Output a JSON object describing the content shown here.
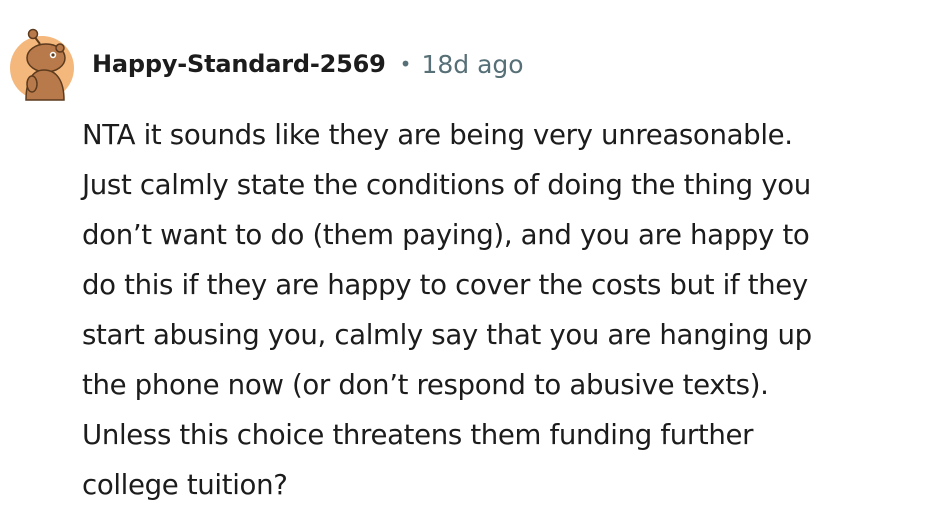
{
  "comment": {
    "author": "Happy-Standard-2569",
    "separator": "•",
    "age": "18d ago",
    "avatar_icon": "reddit-snoo-avatar-icon",
    "avatar_colors": {
      "background": "#f4b77c",
      "snoo": "#b87a4a",
      "outline": "#5c3a1e"
    },
    "body_lines": [
      "NTA it sounds like they are being very unreasonable.",
      "Just calmly state the conditions of doing the thing you",
      "don’t want to do (them paying), and you are happy to",
      "do this if they are happy to cover the costs but if they",
      "start abusing you, calmly say that you are hanging up",
      "the phone now (or don’t respond to abusive texts).",
      "Unless this choice threatens them funding further",
      "college tuition?"
    ]
  }
}
